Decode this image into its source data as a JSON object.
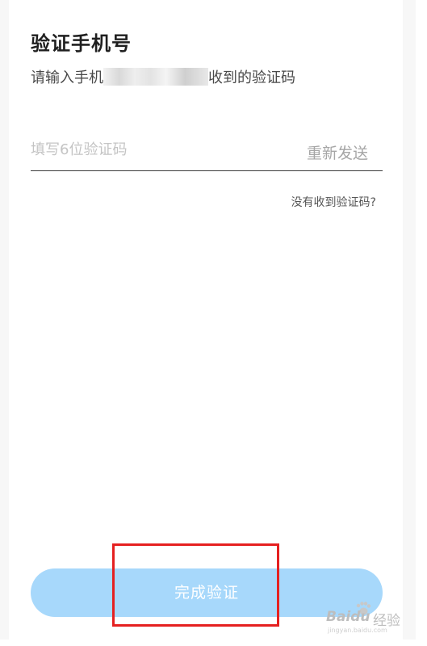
{
  "page": {
    "title": "验证手机号",
    "subtitle_prefix": "请输入手机",
    "subtitle_suffix": "收到的验证码"
  },
  "code_field": {
    "placeholder": "填写6位验证码",
    "resend_label": "重新发送"
  },
  "help_link": "没有收到验证码?",
  "submit_label": "完成验证",
  "watermark": {
    "brand": "Baidu",
    "suffix": "经验",
    "url": "jingyan.baidu.com"
  },
  "colors": {
    "submit_bg": "#a7d8fb",
    "annotation": "#e52020"
  }
}
